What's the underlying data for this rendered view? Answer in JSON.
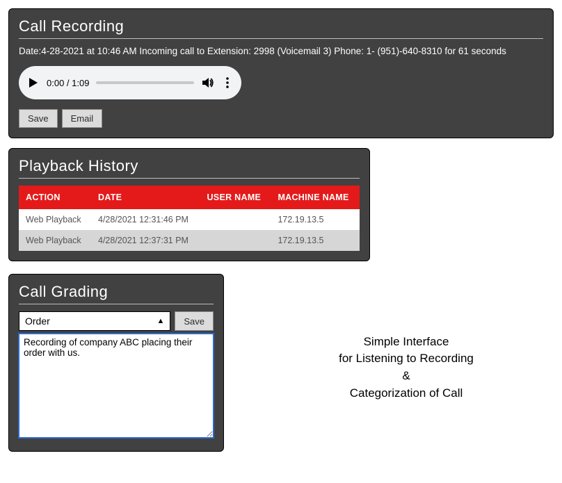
{
  "recording": {
    "title": "Call Recording",
    "details": "Date:4-28-2021 at 10:46 AM Incoming call to Extension: 2998 (Voicemail 3) Phone: 1- (951)-640-8310 for 61 seconds",
    "player": {
      "time_label": "0:00 / 1:09"
    },
    "buttons": {
      "save": "Save",
      "email": "Email"
    }
  },
  "playback": {
    "title": "Playback History",
    "columns": {
      "action": "ACTION",
      "date": "DATE",
      "user": "USER NAME",
      "machine": "MACHINE NAME"
    },
    "rows": [
      {
        "action": "Web Playback",
        "date": "4/28/2021 12:31:46 PM",
        "user": "",
        "machine": "172.19.13.5"
      },
      {
        "action": "Web Playback",
        "date": "4/28/2021 12:37:31 PM",
        "user": "",
        "machine": "172.19.13.5"
      }
    ]
  },
  "grading": {
    "title": "Call Grading",
    "category_selected": "Order",
    "save_label": "Save",
    "notes": "Recording of company ABC placing their order with us."
  },
  "caption": {
    "line1": "Simple Interface",
    "line2": "for Listening to Recording",
    "line3": "&",
    "line4": "Categorization of Call"
  }
}
